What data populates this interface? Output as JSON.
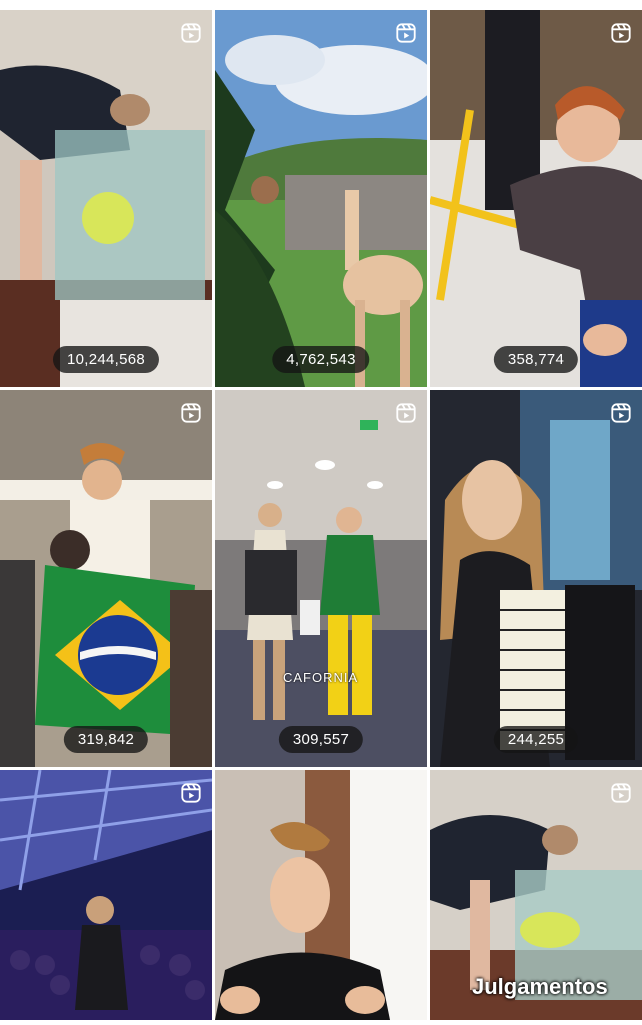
{
  "reels": [
    {
      "views": "10,244,568",
      "overlay": "",
      "caption": ""
    },
    {
      "views": "4,762,543",
      "overlay": "",
      "caption": ""
    },
    {
      "views": "358,774",
      "overlay": "",
      "caption": ""
    },
    {
      "views": "319,842",
      "overlay": "",
      "caption": ""
    },
    {
      "views": "309,557",
      "overlay": "CAFORNIA",
      "caption": ""
    },
    {
      "views": "244,255",
      "overlay": "",
      "caption": ""
    },
    {
      "views": "",
      "overlay": "",
      "caption": ""
    },
    {
      "views": "",
      "overlay": "",
      "caption": ""
    },
    {
      "views": "",
      "overlay": "",
      "caption": "Julgamentos"
    }
  ],
  "icons": {
    "reel": "reels-icon"
  }
}
